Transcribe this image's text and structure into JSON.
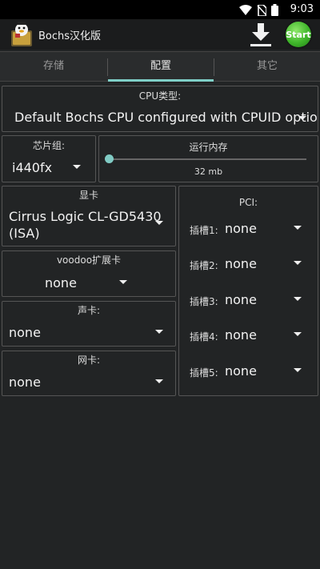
{
  "status": {
    "time": "9:03"
  },
  "app": {
    "title": "Bochs汉化版",
    "start_label": "Start"
  },
  "tabs": [
    {
      "label": "存储"
    },
    {
      "label": "配置"
    },
    {
      "label": "其它"
    }
  ],
  "cpu": {
    "label": "CPU类型:",
    "value": "Default Bochs CPU configured with CPUID option"
  },
  "chipset": {
    "label": "芯片组:",
    "value": "i440fx"
  },
  "memory": {
    "label": "运行内存",
    "value": "32 mb",
    "slider_fraction": 0.0
  },
  "video": {
    "label": "显卡",
    "value_line1": "Cirrus Logic CL-GD5430",
    "value_line2": "(ISA)"
  },
  "voodoo": {
    "label": "voodoo扩展卡",
    "value": "none"
  },
  "sound": {
    "label": "声卡:",
    "value": "none"
  },
  "network": {
    "label": "网卡:",
    "value": "none"
  },
  "pci": {
    "label": "PCI:",
    "slots": [
      {
        "label": "插槽1:",
        "value": "none"
      },
      {
        "label": "插槽2:",
        "value": "none"
      },
      {
        "label": "插槽3:",
        "value": "none"
      },
      {
        "label": "插槽4:",
        "value": "none"
      },
      {
        "label": "插槽5:",
        "value": "none"
      }
    ]
  },
  "colors": {
    "accent": "#80cbc4",
    "start_green": "#3fb52a",
    "background": "#222425"
  }
}
